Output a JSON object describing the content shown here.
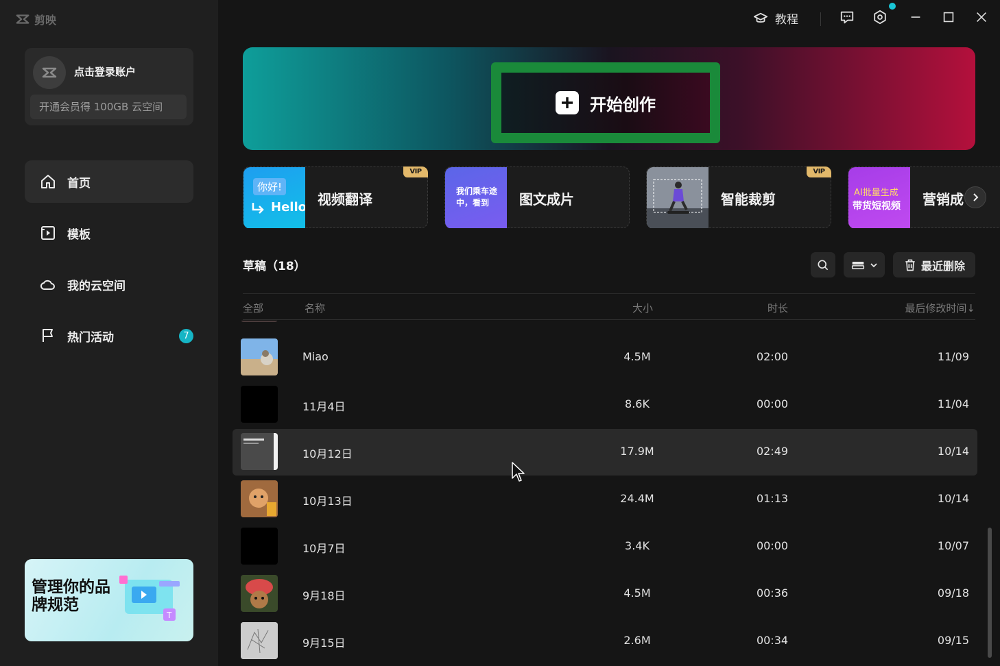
{
  "app": {
    "name": "剪映"
  },
  "account": {
    "login_label": "点击登录账户",
    "vip_label": "开通会员得 100GB 云空间"
  },
  "nav": [
    {
      "label": "首页",
      "icon": "home-icon",
      "active": true
    },
    {
      "label": "模板",
      "icon": "template-icon",
      "active": false
    },
    {
      "label": "我的云空间",
      "icon": "cloud-icon",
      "active": false
    },
    {
      "label": "热门活动",
      "icon": "flag-icon",
      "active": false,
      "badge": "7"
    }
  ],
  "promo": {
    "text": "管理你的品牌规范"
  },
  "titlebar": {
    "tutorial_label": "教程"
  },
  "hero": {
    "create_label": "开始创作"
  },
  "features": [
    {
      "title": "视频翻译",
      "vip": true,
      "thumb_text_1": "你好!",
      "thumb_text_2": "Hello"
    },
    {
      "title": "图文成片",
      "vip": false,
      "thumb_text_1": "我们乘车途",
      "thumb_text_2": "中，看到"
    },
    {
      "title": "智能裁剪",
      "vip": true
    },
    {
      "title": "营销成",
      "vip": false,
      "thumb_text_1": "AI批量生成",
      "thumb_text_2": "带货短视频"
    }
  ],
  "vip_label": "VIP",
  "drafts": {
    "title": "草稿（18）",
    "recent_delete_label": "最近删除",
    "columns": {
      "all": "全部",
      "name": "名称",
      "size": "大小",
      "duration": "时长",
      "modified": "最后修改时间↓"
    },
    "rows": [
      {
        "name": "Miao",
        "size": "4.5M",
        "duration": "02:00",
        "date": "11/09",
        "thumb": "cat-beach"
      },
      {
        "name": "11月4日",
        "size": "8.6K",
        "duration": "00:00",
        "date": "11/04",
        "thumb": "black"
      },
      {
        "name": "10月12日",
        "size": "17.9M",
        "duration": "02:49",
        "date": "10/14",
        "thumb": "document",
        "hover": true
      },
      {
        "name": "10月13日",
        "size": "24.4M",
        "duration": "01:13",
        "date": "10/14",
        "thumb": "cat-orange"
      },
      {
        "name": "10月7日",
        "size": "3.4K",
        "duration": "00:00",
        "date": "10/07",
        "thumb": "black"
      },
      {
        "name": "9月18日",
        "size": "4.5M",
        "duration": "00:36",
        "date": "09/18",
        "thumb": "cat-hat"
      },
      {
        "name": "9月15日",
        "size": "2.6M",
        "duration": "00:34",
        "date": "09/15",
        "thumb": "sketch"
      }
    ]
  },
  "colors": {
    "accent": "#16b5c5",
    "highlight_border": "#1a8a3a",
    "vip_gold": "#e2b86a"
  }
}
